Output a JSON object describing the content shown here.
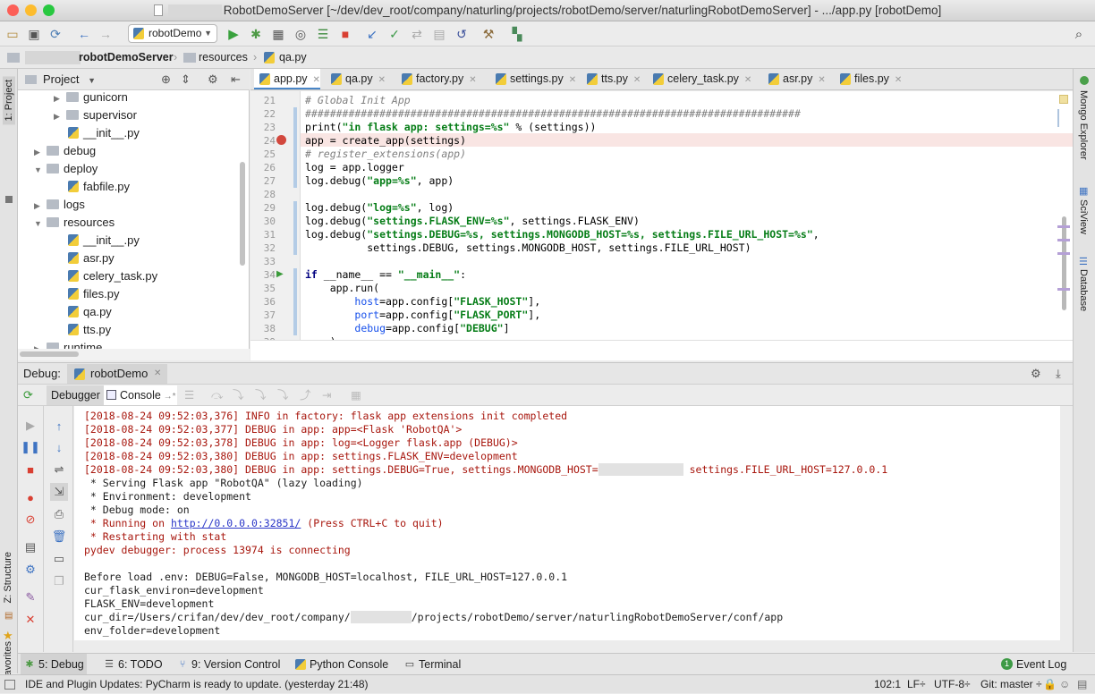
{
  "window": {
    "title": "RobotDemoServer [~/dev/dev_root/company/naturling/projects/robotDemo/server/naturlingRobotDemoServer] - .../app.py [robotDemo]"
  },
  "toolbar": {
    "run_config": "robotDemo"
  },
  "navbar": {
    "crumbs": [
      "robotDemoServer",
      "resources",
      "qa.py"
    ]
  },
  "sidebar": {
    "project": "1: Project",
    "structure": "Z: Structure",
    "favorites": "2: Favorites"
  },
  "rightbar": {
    "mongo": "Mongo Explorer",
    "sciview": "SciView",
    "database": "Database"
  },
  "project": {
    "title": "Project",
    "tree": [
      {
        "label": "gunicorn",
        "type": "folder",
        "indent": 2,
        "arrow": "▶"
      },
      {
        "label": "supervisor",
        "type": "folder",
        "indent": 2,
        "arrow": "▶"
      },
      {
        "label": "__init__.py",
        "type": "file",
        "indent": 2,
        "arrow": ""
      },
      {
        "label": "debug",
        "type": "folder",
        "indent": 1,
        "arrow": "▶"
      },
      {
        "label": "deploy",
        "type": "folder",
        "indent": 1,
        "arrow": "▼"
      },
      {
        "label": "fabfile.py",
        "type": "file",
        "indent": 2,
        "arrow": ""
      },
      {
        "label": "logs",
        "type": "folder",
        "indent": 1,
        "arrow": "▶"
      },
      {
        "label": "resources",
        "type": "folder",
        "indent": 1,
        "arrow": "▼"
      },
      {
        "label": "__init__.py",
        "type": "file",
        "indent": 2,
        "arrow": ""
      },
      {
        "label": "asr.py",
        "type": "file",
        "indent": 2,
        "arrow": ""
      },
      {
        "label": "celery_task.py",
        "type": "file",
        "indent": 2,
        "arrow": ""
      },
      {
        "label": "files.py",
        "type": "file",
        "indent": 2,
        "arrow": ""
      },
      {
        "label": "qa.py",
        "type": "file",
        "indent": 2,
        "arrow": ""
      },
      {
        "label": "tts.py",
        "type": "file",
        "indent": 2,
        "arrow": ""
      },
      {
        "label": "runtime",
        "type": "folder",
        "indent": 1,
        "arrow": "▶"
      }
    ]
  },
  "editor": {
    "tabs": [
      "app.py",
      "qa.py",
      "factory.py",
      "settings.py",
      "tts.py",
      "celery_task.py",
      "asr.py",
      "files.py"
    ],
    "lines": [
      {
        "n": "21",
        "html": "<span class='cmt'># Global Init App</span>"
      },
      {
        "n": "22",
        "html": "<span class='cmt'>################################################################################</span>"
      },
      {
        "n": "23",
        "html": "print(<span class='str'>\"in flask app: settings=%s\"</span> % (settings))"
      },
      {
        "n": "24",
        "html": "app = create_app(settings)"
      },
      {
        "n": "25",
        "html": "<span class='cmt'># register_extensions(app)</span>"
      },
      {
        "n": "26",
        "html": "log = app.logger"
      },
      {
        "n": "27",
        "html": "log.debug(<span class='str'>\"app=%s\"</span>, app)"
      },
      {
        "n": "28",
        "html": ""
      },
      {
        "n": "29",
        "html": "log.debug(<span class='str'>\"log=%s\"</span>, log)"
      },
      {
        "n": "30",
        "html": "log.debug(<span class='str'>\"settings.FLASK_ENV=%s\"</span>, settings.FLASK_ENV)"
      },
      {
        "n": "31",
        "html": "log.debug(<span class='str'>\"settings.DEBUG=%s, settings.MONGODB_HOST=%s, settings.FILE_URL_HOST=%s\"</span>,"
      },
      {
        "n": "32",
        "html": "          settings.DEBUG, settings.MONGODB_HOST, settings.FILE_URL_HOST)"
      },
      {
        "n": "33",
        "html": ""
      },
      {
        "n": "34",
        "html": "<span class='kw'>if</span> __name__ == <span class='str'>\"__main__\"</span>:"
      },
      {
        "n": "35",
        "html": "    app.run("
      },
      {
        "n": "36",
        "html": "        <span class='var'>host</span>=app.config[<span class='str'>\"FLASK_HOST\"</span>],"
      },
      {
        "n": "37",
        "html": "        <span class='var'>port</span>=app.config[<span class='str'>\"FLASK_PORT\"</span>],"
      },
      {
        "n": "38",
        "html": "        <span class='var'>debug</span>=app.config[<span class='str'>\"DEBUG\"</span>]"
      },
      {
        "n": "39",
        "html": "    )"
      }
    ]
  },
  "debug": {
    "label": "Debug:",
    "session": "robotDemo",
    "tab_debugger": "Debugger",
    "tab_console": "Console"
  },
  "console": {
    "lines": [
      {
        "c": "red",
        "html": "[2018-08-24 09:52:03,376] INFO in factory: flask app extensions init completed"
      },
      {
        "c": "red",
        "html": "[2018-08-24 09:52:03,377] DEBUG in app: app=&lt;Flask 'RobotQA'&gt;"
      },
      {
        "c": "red",
        "html": "[2018-08-24 09:52:03,378] DEBUG in app: log=&lt;Logger flask.app (DEBUG)&gt;"
      },
      {
        "c": "red",
        "html": "[2018-08-24 09:52:03,380] DEBUG in app: settings.FLASK_ENV=development"
      },
      {
        "c": "red",
        "html": "[2018-08-24 09:52:03,380] DEBUG in app: settings.DEBUG=True, settings.MONGODB_HOST=<span class='blur' style='width:95px'></span> settings.FILE_URL_HOST=127.0.0.1"
      },
      {
        "c": "blk",
        "html": " * Serving Flask app \"RobotQA\" (lazy loading)"
      },
      {
        "c": "blk",
        "html": " * Environment: development"
      },
      {
        "c": "blk",
        "html": " * Debug mode: on"
      },
      {
        "c": "red",
        "html": " * Running on <span class='lnk'>http://0.0.0.0:32851/</span> (Press CTRL+C to quit)"
      },
      {
        "c": "red",
        "html": " * Restarting with stat"
      },
      {
        "c": "red",
        "html": "pydev debugger: process 13974 is connecting"
      },
      {
        "c": "blk",
        "html": ""
      },
      {
        "c": "blk",
        "html": "Before load .env: DEBUG=False, MONGODB_HOST=localhost, FILE_URL_HOST=127.0.0.1"
      },
      {
        "c": "blk",
        "html": "cur_flask_environ=development"
      },
      {
        "c": "blk",
        "html": "FLASK_ENV=development"
      },
      {
        "c": "blk",
        "html": "cur_dir=/Users/crifan/dev/dev_root/company/<span class='blur' style='width:68px'></span>/projects/robotDemo/server/naturlingRobotDemoServer/conf/app"
      },
      {
        "c": "blk",
        "html": "env_folder=development"
      }
    ]
  },
  "bottom": {
    "debug": "5: Debug",
    "todo": "6: TODO",
    "vcs": "9: Version Control",
    "pyconsole": "Python Console",
    "terminal": "Terminal",
    "eventlog": "Event Log"
  },
  "status": {
    "message": "IDE and Plugin Updates: PyCharm is ready to update. (yesterday 21:48)",
    "position": "102:1",
    "lineend": "LF÷",
    "encoding": "UTF-8÷",
    "git": "Git: master ÷"
  }
}
